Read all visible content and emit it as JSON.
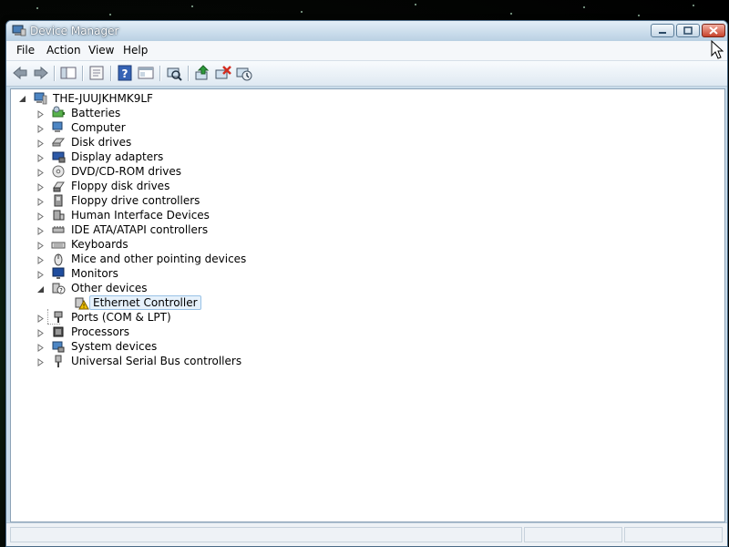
{
  "window": {
    "title": "Device Manager"
  },
  "menu": [
    "File",
    "Action",
    "View",
    "Help"
  ],
  "toolbar": {
    "icons": [
      "back-arrow-icon",
      "forward-arrow-icon",
      "show-hide-console-tree-icon",
      "properties-icon",
      "help-icon",
      "view-pane-icon",
      "scan-hardware-changes-icon",
      "update-driver-icon",
      "uninstall-icon",
      "enable-device-icon"
    ]
  },
  "tree": {
    "root": "THE-JUUJKHMK9LF",
    "categories": [
      {
        "label": "Batteries",
        "icon": "battery-icon",
        "expanded": false
      },
      {
        "label": "Computer",
        "icon": "computer-icon",
        "expanded": false
      },
      {
        "label": "Disk drives",
        "icon": "disk-drive-icon",
        "expanded": false
      },
      {
        "label": "Display adapters",
        "icon": "display-adapter-icon",
        "expanded": false
      },
      {
        "label": "DVD/CD-ROM drives",
        "icon": "dvd-drive-icon",
        "expanded": false
      },
      {
        "label": "Floppy disk drives",
        "icon": "floppy-disk-icon",
        "expanded": false
      },
      {
        "label": "Floppy drive controllers",
        "icon": "floppy-controller-icon",
        "expanded": false
      },
      {
        "label": "Human Interface Devices",
        "icon": "hid-icon",
        "expanded": false
      },
      {
        "label": "IDE ATA/ATAPI controllers",
        "icon": "ide-controller-icon",
        "expanded": false
      },
      {
        "label": "Keyboards",
        "icon": "keyboard-icon",
        "expanded": false
      },
      {
        "label": "Mice and other pointing devices",
        "icon": "mouse-icon",
        "expanded": false
      },
      {
        "label": "Monitors",
        "icon": "monitor-icon",
        "expanded": false
      },
      {
        "label": "Other devices",
        "icon": "unknown-device-icon",
        "expanded": true
      },
      {
        "label": "Ethernet Controller",
        "icon": "warning-device-icon",
        "child": true,
        "selected": true
      },
      {
        "label": "Ports (COM & LPT)",
        "icon": "port-icon",
        "expanded": false
      },
      {
        "label": "Processors",
        "icon": "processor-icon",
        "expanded": false
      },
      {
        "label": "System devices",
        "icon": "system-device-icon",
        "expanded": false
      },
      {
        "label": "Universal Serial Bus controllers",
        "icon": "usb-icon",
        "expanded": false
      }
    ]
  },
  "colors": {
    "titlebar": "#c9dcea",
    "selection": "#e6f1fb",
    "warning": "#f2c200"
  }
}
